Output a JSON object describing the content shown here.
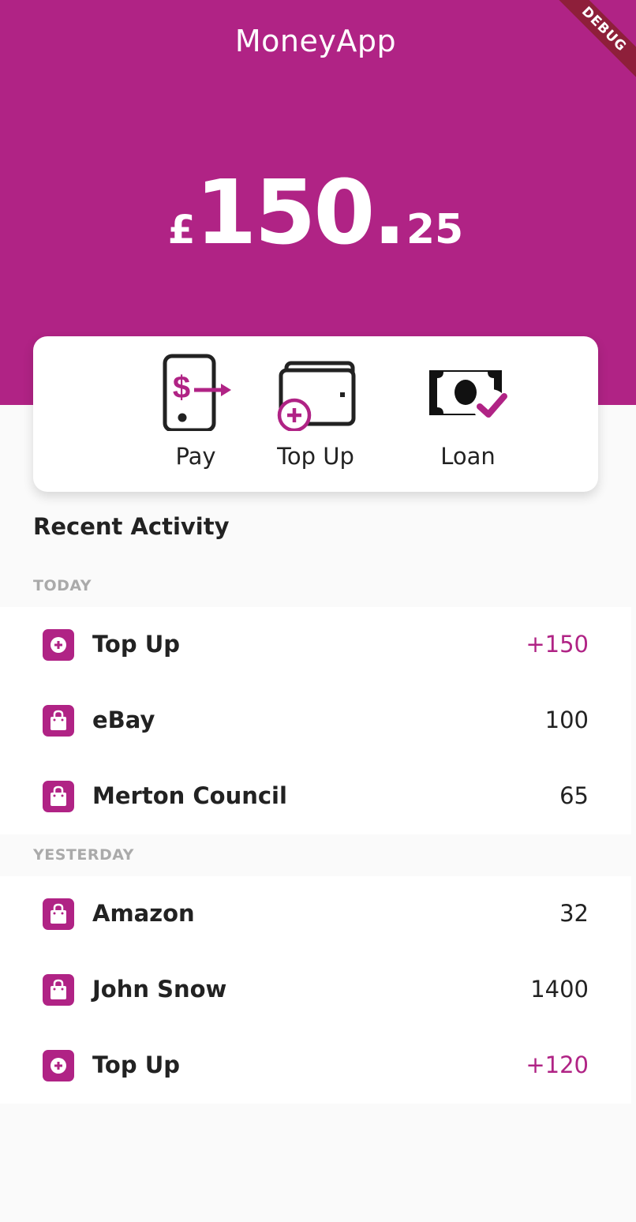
{
  "app": {
    "title": "MoneyApp",
    "debug_label": "DEBUG",
    "brand_color": "#b02385"
  },
  "balance": {
    "currency": "£",
    "integer": "150",
    "dot": ".",
    "decimal": "25"
  },
  "actions": [
    {
      "label": "Pay",
      "icon": "phone-dollar-send-icon"
    },
    {
      "label": "Top Up",
      "icon": "wallet-plus-icon"
    },
    {
      "label": "Loan",
      "icon": "money-check-icon"
    }
  ],
  "recent_activity": {
    "heading": "Recent Activity",
    "groups": [
      {
        "label": "TODAY",
        "items": [
          {
            "name": "Top Up",
            "amount": "+150",
            "type": "topup",
            "icon": "plus-circle-icon"
          },
          {
            "name": "eBay",
            "amount": "100",
            "type": "purchase",
            "icon": "shopping-bag-icon"
          },
          {
            "name": "Merton Council",
            "amount": "65",
            "type": "purchase",
            "icon": "shopping-bag-icon"
          }
        ]
      },
      {
        "label": "YESTERDAY",
        "items": [
          {
            "name": "Amazon",
            "amount": "32",
            "type": "purchase",
            "icon": "shopping-bag-icon"
          },
          {
            "name": "John Snow",
            "amount": "1400",
            "type": "purchase",
            "icon": "shopping-bag-icon"
          },
          {
            "name": "Top Up",
            "amount": "+120",
            "type": "topup",
            "icon": "plus-circle-icon"
          }
        ]
      }
    ]
  }
}
